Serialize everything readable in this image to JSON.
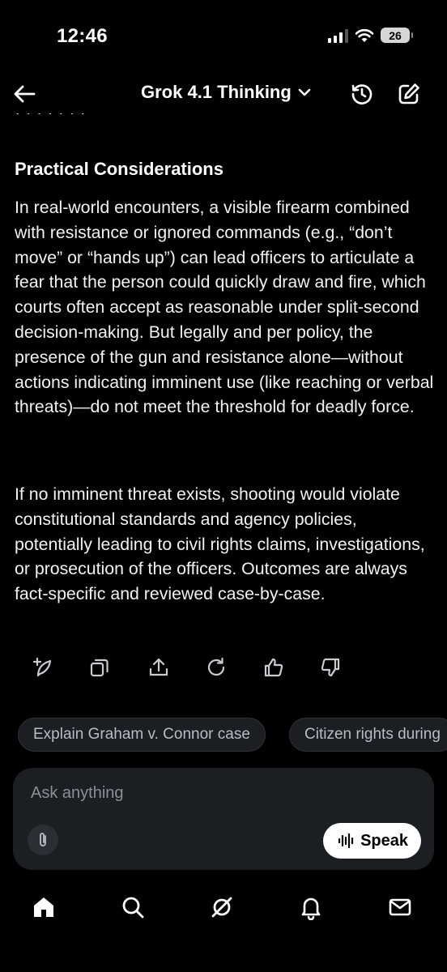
{
  "status_bar": {
    "time": "12:46",
    "battery_level": "26",
    "signal_bars_active": 3
  },
  "header": {
    "model_name": "Grok 4.1 Thinking",
    "icons": [
      "back-arrow-icon",
      "chevron-down-icon",
      "history-icon",
      "new-chat-icon"
    ]
  },
  "content": {
    "section_title": "Practical Considerations",
    "paragraphs": [
      "In real-world encounters, a visible firearm combined with resistance or ignored commands (e.g., “don’t move” or “hands up”) can lead officers to articulate a fear that the person could quickly draw and fire, which courts often accept as reasonable under split-second decision-making. But legally and per policy, the presence of the gun and resistance alone—without actions indicating imminent use (like reaching or verbal threats)—do not meet the threshold for deadly force.",
      "If no imminent threat exists, shooting would violate constitutional standards and agency policies, potentially leading to civil rights claims, investigations, or prosecution of the officers. Outcomes are always fact-specific and reviewed case-by-case."
    ]
  },
  "actions": [
    "edit-sparkle-icon",
    "copy-icon",
    "share-icon",
    "regenerate-icon",
    "thumbs-up-icon",
    "thumbs-down-icon"
  ],
  "suggestions": [
    "Explain Graham v. Connor case",
    "Citizen rights during"
  ],
  "composer": {
    "placeholder": "Ask anything",
    "speak_label": "Speak"
  },
  "bottom_nav": [
    "home-icon",
    "search-icon",
    "grok-icon",
    "notifications-icon",
    "messages-icon"
  ],
  "colors": {
    "background": "#000000",
    "chip_background": "#1c1e22",
    "muted_text": "#8c8f95"
  }
}
